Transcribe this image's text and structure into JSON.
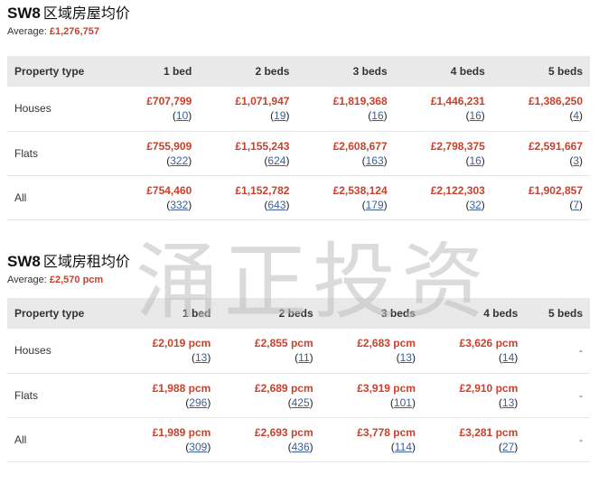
{
  "sale": {
    "title_code": "SW8",
    "title_cn": "区域房屋均价",
    "average_label": "Average:",
    "average_value": "£1,276,757",
    "headers": [
      "Property type",
      "1 bed",
      "2 beds",
      "3 beds",
      "4 beds",
      "5 beds"
    ],
    "rows": [
      {
        "type": "Houses",
        "cells": [
          {
            "price": "£707,799",
            "count": "10"
          },
          {
            "price": "£1,071,947",
            "count": "19"
          },
          {
            "price": "£1,819,368",
            "count": "16"
          },
          {
            "price": "£1,446,231",
            "count": "16"
          },
          {
            "price": "£1,386,250",
            "count": "4"
          }
        ]
      },
      {
        "type": "Flats",
        "cells": [
          {
            "price": "£755,909",
            "count": "322"
          },
          {
            "price": "£1,155,243",
            "count": "624"
          },
          {
            "price": "£2,608,677",
            "count": "163"
          },
          {
            "price": "£2,798,375",
            "count": "16"
          },
          {
            "price": "£2,591,667",
            "count": "3"
          }
        ]
      },
      {
        "type": "All",
        "cells": [
          {
            "price": "£754,460",
            "count": "332"
          },
          {
            "price": "£1,152,782",
            "count": "643"
          },
          {
            "price": "£2,538,124",
            "count": "179"
          },
          {
            "price": "£2,122,303",
            "count": "32"
          },
          {
            "price": "£1,902,857",
            "count": "7"
          }
        ]
      }
    ]
  },
  "rent": {
    "title_code": "SW8",
    "title_cn": "区域房租均价",
    "average_label": "Average:",
    "average_value": "£2,570 pcm",
    "headers": [
      "Property type",
      "1 bed",
      "2 beds",
      "3 beds",
      "4 beds",
      "5 beds"
    ],
    "rows": [
      {
        "type": "Houses",
        "cells": [
          {
            "price": "£2,019 pcm",
            "count": "13"
          },
          {
            "price": "£2,855 pcm",
            "count": "11"
          },
          {
            "price": "£2,683 pcm",
            "count": "13"
          },
          {
            "price": "£3,626 pcm",
            "count": "14"
          },
          {
            "dash": "-"
          }
        ]
      },
      {
        "type": "Flats",
        "cells": [
          {
            "price": "£1,988 pcm",
            "count": "296"
          },
          {
            "price": "£2,689 pcm",
            "count": "425"
          },
          {
            "price": "£3,919 pcm",
            "count": "101"
          },
          {
            "price": "£2,910 pcm",
            "count": "13"
          },
          {
            "dash": "-"
          }
        ]
      },
      {
        "type": "All",
        "cells": [
          {
            "price": "£1,989 pcm",
            "count": "309"
          },
          {
            "price": "£2,693 pcm",
            "count": "436"
          },
          {
            "price": "£3,778 pcm",
            "count": "114"
          },
          {
            "price": "£3,281 pcm",
            "count": "27"
          },
          {
            "dash": "-"
          }
        ]
      }
    ]
  },
  "watermark": "涌正投资"
}
